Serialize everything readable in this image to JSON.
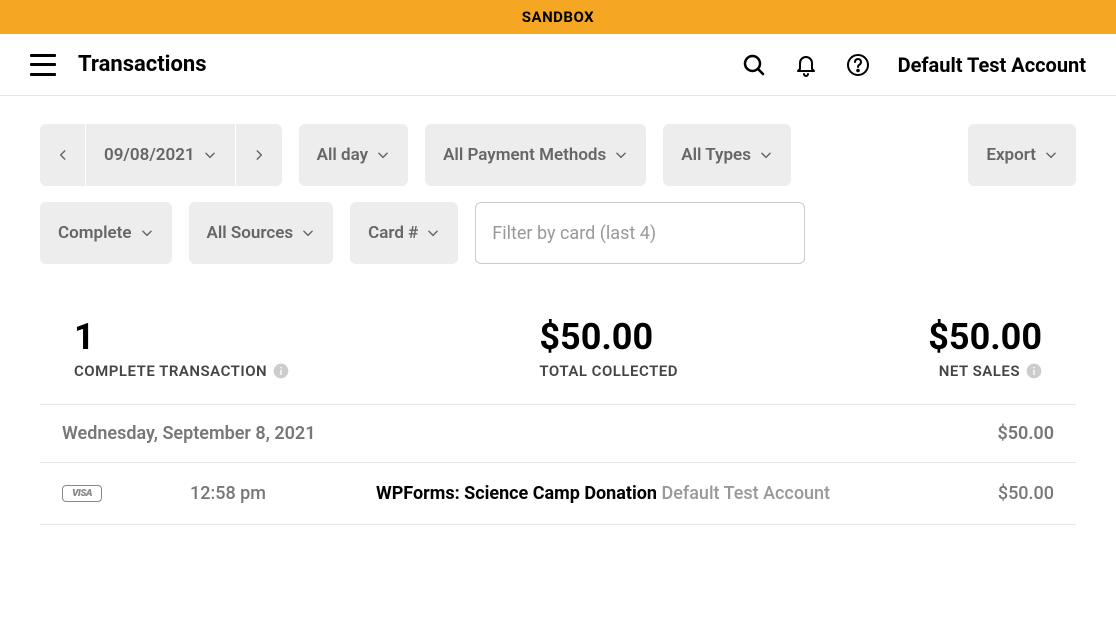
{
  "banner": "SANDBOX",
  "page_title": "Transactions",
  "account_name": "Default Test Account",
  "filters": {
    "date": "09/08/2021",
    "time": "All day",
    "payment_methods": "All Payment Methods",
    "types": "All Types",
    "export": "Export",
    "status": "Complete",
    "sources": "All Sources",
    "card_num": "Card #",
    "card_filter_placeholder": "Filter by card (last 4)"
  },
  "summary": {
    "count": {
      "value": "1",
      "label": "COMPLETE TRANSACTION"
    },
    "collected": {
      "value": "$50.00",
      "label": "TOTAL COLLECTED"
    },
    "net": {
      "value": "$50.00",
      "label": "NET SALES"
    }
  },
  "date_group": {
    "label": "Wednesday, September 8, 2021",
    "total": "$50.00"
  },
  "transaction": {
    "card_brand": "VISA",
    "time": "12:58 pm",
    "primary": "WPForms: Science Camp Donation",
    "secondary": "Default Test Account",
    "amount": "$50.00"
  }
}
